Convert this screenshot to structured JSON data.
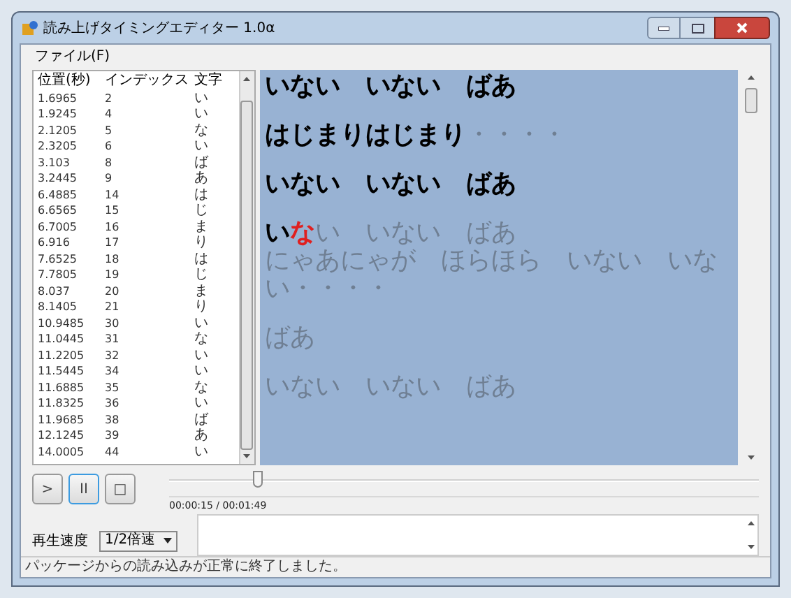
{
  "window": {
    "title": "読み上げタイミングエディター 1.0α"
  },
  "menu": [
    {
      "label": "ファイル(F)"
    }
  ],
  "table": {
    "columns": [
      "位置(秒)",
      "インデックス",
      "文字"
    ],
    "rows": [
      [
        "1.6965",
        "2",
        "い"
      ],
      [
        "1.9245",
        "4",
        "い"
      ],
      [
        "2.1205",
        "5",
        "な"
      ],
      [
        "2.3205",
        "6",
        "い"
      ],
      [
        "3.103",
        "8",
        "ば"
      ],
      [
        "3.2445",
        "9",
        "あ"
      ],
      [
        "6.4885",
        "14",
        "は"
      ],
      [
        "6.6565",
        "15",
        "じ"
      ],
      [
        "6.7005",
        "16",
        "ま"
      ],
      [
        "6.916",
        "17",
        "り"
      ],
      [
        "7.6525",
        "18",
        "は"
      ],
      [
        "7.7805",
        "19",
        "じ"
      ],
      [
        "8.037",
        "20",
        "ま"
      ],
      [
        "8.1405",
        "21",
        "り"
      ],
      [
        "10.9485",
        "30",
        "い"
      ],
      [
        "11.0445",
        "31",
        "な"
      ],
      [
        "11.2205",
        "32",
        "い"
      ],
      [
        "11.5445",
        "34",
        "い"
      ],
      [
        "11.6885",
        "35",
        "な"
      ],
      [
        "11.8325",
        "36",
        "い"
      ],
      [
        "11.9685",
        "38",
        "ば"
      ],
      [
        "12.1245",
        "39",
        "あ"
      ],
      [
        "14.0005",
        "44",
        "い"
      ]
    ]
  },
  "lyrics": [
    {
      "lines": [
        {
          "segments": [
            {
              "kind": "read",
              "text": "いない　いない　ばあ"
            }
          ]
        }
      ]
    },
    {
      "lines": [
        {
          "segments": [
            {
              "kind": "read",
              "text": "はじまりはじまり"
            },
            {
              "kind": "unread",
              "text": "・・・・"
            }
          ]
        }
      ]
    },
    {
      "lines": [
        {
          "segments": [
            {
              "kind": "read",
              "text": "いない　いない　ばあ"
            }
          ]
        }
      ]
    },
    {
      "lines": [
        {
          "segments": [
            {
              "kind": "read",
              "text": "い"
            },
            {
              "kind": "current",
              "text": "な"
            },
            {
              "kind": "unread",
              "text": "い　いない　ばあ"
            }
          ]
        },
        {
          "segments": [
            {
              "kind": "unread",
              "text": "にゃあにゃが　ほらほら　いない　いない・・・・"
            }
          ]
        }
      ]
    },
    {
      "lines": [
        {
          "segments": [
            {
              "kind": "unread",
              "text": "ばあ"
            }
          ]
        }
      ]
    },
    {
      "lines": [
        {
          "segments": [
            {
              "kind": "unread",
              "text": "いない　いない　ばあ"
            }
          ]
        }
      ]
    }
  ],
  "transport": [
    {
      "label": ">",
      "selected": false
    },
    {
      "label": "II",
      "selected": true
    },
    {
      "label": "□",
      "selected": false
    }
  ],
  "seek": {
    "level": 0.15
  },
  "time": "00:00:15 / 00:01:49",
  "speed": {
    "label": "再生速度",
    "value": "1/2倍速"
  },
  "status_bar": "パッケージからの読み込みが正常に終了しました。"
}
